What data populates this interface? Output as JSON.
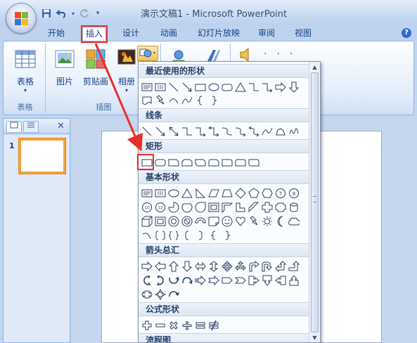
{
  "window": {
    "title": "演示文稿1 - Microsoft PowerPoint"
  },
  "tabs": [
    {
      "label": "开始"
    },
    {
      "label": "插入",
      "active": true
    },
    {
      "label": "设计"
    },
    {
      "label": "动画"
    },
    {
      "label": "幻灯片放映"
    },
    {
      "label": "审阅"
    },
    {
      "label": "视图"
    }
  ],
  "help": {
    "glyph": "?"
  },
  "ribbon": {
    "groups": [
      {
        "label": "表格",
        "buttons": [
          {
            "label": "表格",
            "icon": "table-icon"
          }
        ]
      },
      {
        "label": "插图",
        "buttons": [
          {
            "label": "图片",
            "icon": "picture-icon"
          },
          {
            "label": "剪贴画",
            "icon": "clipart-icon"
          },
          {
            "label": "相册",
            "icon": "photo-album-icon"
          }
        ]
      }
    ]
  },
  "slides_pane": {
    "slide_number": "1"
  },
  "shapes_menu": {
    "sections": [
      {
        "title": "最近使用的形状"
      },
      {
        "title": "线条"
      },
      {
        "title": "矩形"
      },
      {
        "title": "基本形状"
      },
      {
        "title": "箭头总汇"
      },
      {
        "title": "公式形状"
      },
      {
        "title": "流程图"
      }
    ],
    "shape_glyphs": {
      "braces": "{ }",
      "brackets": "[ ]"
    }
  },
  "colors": {
    "highlight": "#e8302a",
    "accent": "#15428b",
    "slide_border": "#f6a23a"
  }
}
